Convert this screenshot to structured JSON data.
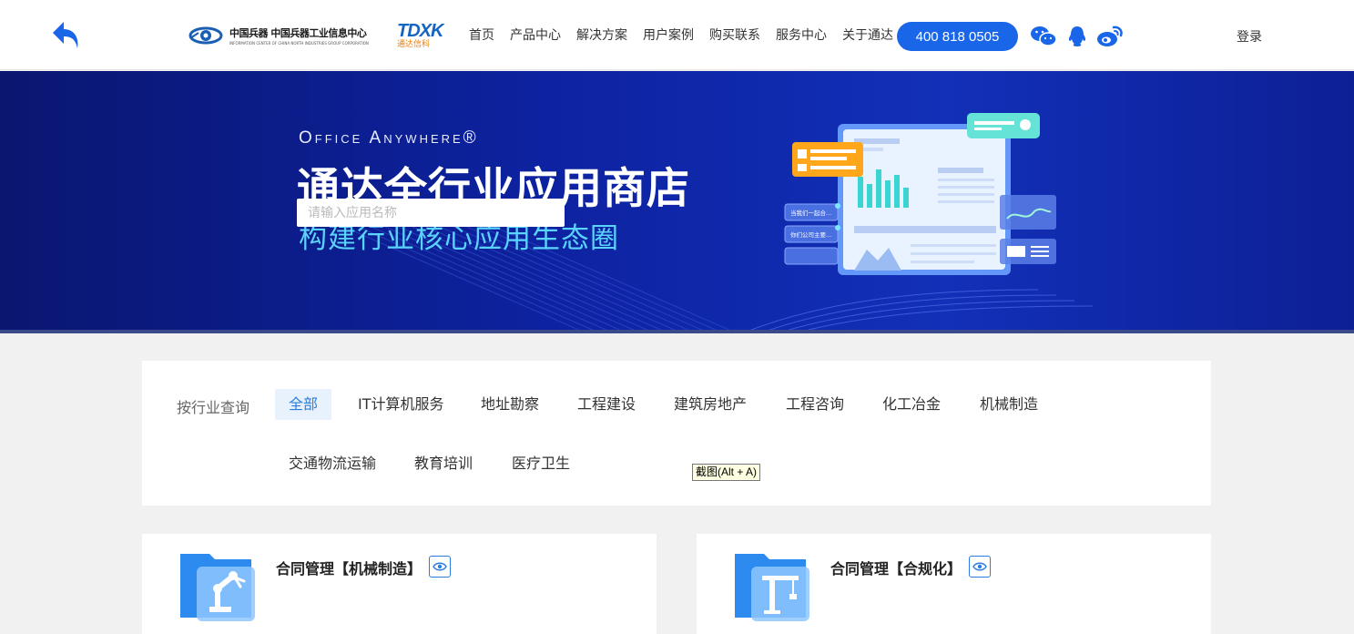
{
  "header": {
    "logo": {
      "cn_name": "中国兵器 中国兵器工业信息中心",
      "en_name": "INFORMATION CENTER OF CHINA NORTH INDUSTRIES GROUP CORPORATION",
      "brand_mark": "TDXK",
      "brand_sub": "通达信科"
    },
    "nav": [
      "首页",
      "产品中心",
      "解决方案",
      "用户案例",
      "购买联系",
      "服务中心",
      "关于通达"
    ],
    "phone": "400 818 0505",
    "login_label": "登录",
    "icons": [
      "back-arrow-icon",
      "wechat-icon",
      "qq-icon",
      "weibo-icon"
    ],
    "accent_color": "#1a66e8"
  },
  "banner": {
    "sub_en": "Office Anywhere®",
    "title": "通达全行业应用商店",
    "tagline": "构建行业核心应用生态圈",
    "search_placeholder": "请输入应用名称",
    "bubble_1": "当我们一起合...",
    "bubble_2": "你们公司主要..."
  },
  "filter": {
    "label": "按行业查询",
    "industries": [
      "全部",
      "IT计算机服务",
      "地址勘察",
      "工程建设",
      "建筑房地产",
      "工程咨询",
      "化工冶金",
      "机械制造",
      "交通物流运输",
      "教育培训",
      "医疗卫生"
    ],
    "active": "全部"
  },
  "tooltip": "截图(Alt + A)",
  "apps": [
    {
      "title": "合同管理【机械制造】",
      "icon": "robot-arm-icon"
    },
    {
      "title": "合同管理【合规化】",
      "icon": "tower-crane-icon"
    }
  ]
}
